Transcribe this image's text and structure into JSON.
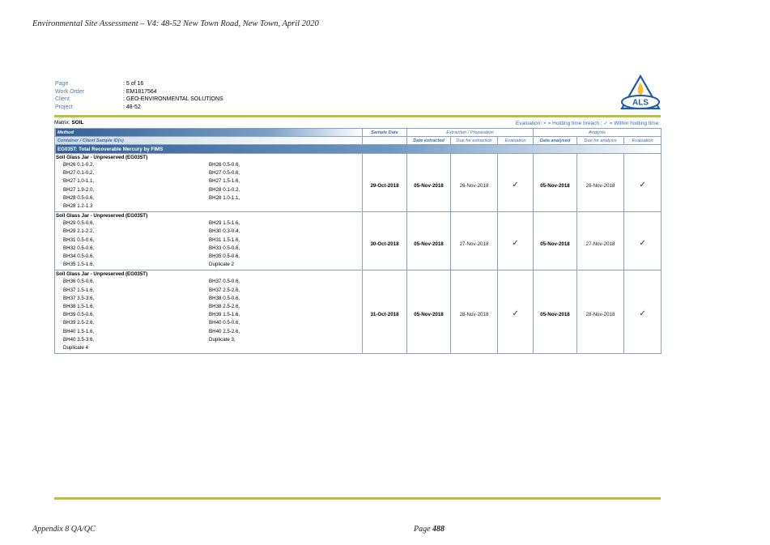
{
  "document": {
    "header_title": "Environmental Site Assessment – V4: 48-52 New Town Road, New Town, April 2020",
    "footer_left": "Appendix 8 QA/QC",
    "footer_page_label": "Page",
    "footer_page_number": "488"
  },
  "info": {
    "page_label": "Page",
    "page_value": ": 5 of 16",
    "work_order_label": "Work Order",
    "work_order_value": ": EM1817564",
    "client_label": "Client",
    "client_value": ": GEO-ENVIRONMENTAL SOLUTIONS",
    "project_label": "Project",
    "project_value": ": 48-52"
  },
  "logo": {
    "text": "ALS",
    "colors": {
      "blue": "#1f5aa6",
      "yellow": "#f2c230"
    }
  },
  "matrix": {
    "label": "Matrix:",
    "value": "SOIL"
  },
  "evaluation_legend": "Evaluation: × = Holding time breach ; ✓ = Within holding time.",
  "table": {
    "headers": {
      "method": "Method",
      "sample_date": "Sample Date",
      "extraction_group": "Extraction / Preparation",
      "analysis_group": "Analysis",
      "container": "Container / Client Sample ID(s)",
      "date_extracted": "Date extracted",
      "due_extraction": "Due for extraction",
      "evaluation": "Evaluation",
      "date_analysed": "Date analysed",
      "due_analysis": "Due for analysis",
      "evaluation2": "Evaluation"
    },
    "section_title": "EG035T: Total Recoverable Mercury by FIMS",
    "groups": [
      {
        "container": "Soil Glass Jar - Unpreserved (EG035T)",
        "samples_left": [
          "BH26 0.1-0.2,",
          "BH27 0.1-0.2,",
          "BH27 1.0-1.1,",
          "BH27 1.9-2.0,",
          "BH28 0.5-0.6,",
          "BH28 1.2-1.3"
        ],
        "samples_right": [
          "BH26 0.5-0.6,",
          "BH27 0.5-0.6,",
          "BH27 1.5-1.6,",
          "BH28 0.1-0.2,",
          "BH28 1.0-1.1,",
          ""
        ],
        "sample_date": "29-Oct-2018",
        "date_extracted": "05-Nov-2018",
        "due_extraction": "26-Nov-2018",
        "eval1": "✓",
        "date_analysed": "05-Nov-2018",
        "due_analysis": "26-Nov-2018",
        "eval2": "✓"
      },
      {
        "container": "Soil Glass Jar - Unpreserved (EG035T)",
        "samples_left": [
          "BH29 0.5-0.6,",
          "BH29 2.1-2.2,",
          "BH31 0.5-0.6,",
          "BH32 0.5-0.6,",
          "BH34 0.5-0.6,",
          "BH35 1.5-1.6,"
        ],
        "samples_right": [
          "BH29 1.5-1.6,",
          "BH30 0.3-0.4,",
          "BH31 1.5-1.6,",
          "BH33 0.5-0.6,",
          "BH35 0.5-0.6,",
          "Duplicate 2"
        ],
        "sample_date": "30-Oct-2018",
        "date_extracted": "05-Nov-2018",
        "due_extraction": "27-Nov-2018",
        "eval1": "✓",
        "date_analysed": "05-Nov-2018",
        "due_analysis": "27-Nov-2018",
        "eval2": "✓"
      },
      {
        "container": "Soil Glass Jar - Unpreserved (EG035T)",
        "samples_left": [
          "BH36 0.5-0.6,",
          "BH37 1.5-1.6,",
          "BH37 3.5-3.6,",
          "BH38 1.5-1.6,",
          "BH39 0.5-0.6,",
          "BH39 2.5-2.6,",
          "BH40 1.5-1.6,",
          "BH40 3.5-3.6,",
          "Duplicate 4"
        ],
        "samples_right": [
          "BH37 0.5-0.6,",
          "BH37 2.5-2.6,",
          "BH38 0.5-0.6,",
          "BH38 2.5-2.6,",
          "BH39 1.5-1.6,",
          "BH40 0.5-0.6,",
          "BH40 2.5-2.6,",
          "Duplicate 3,",
          ""
        ],
        "sample_date": "31-Oct-2018",
        "date_extracted": "05-Nov-2018",
        "due_extraction": "28-Nov-2018",
        "eval1": "✓",
        "date_analysed": "05-Nov-2018",
        "due_analysis": "28-Nov-2018",
        "eval2": "✓"
      }
    ]
  }
}
